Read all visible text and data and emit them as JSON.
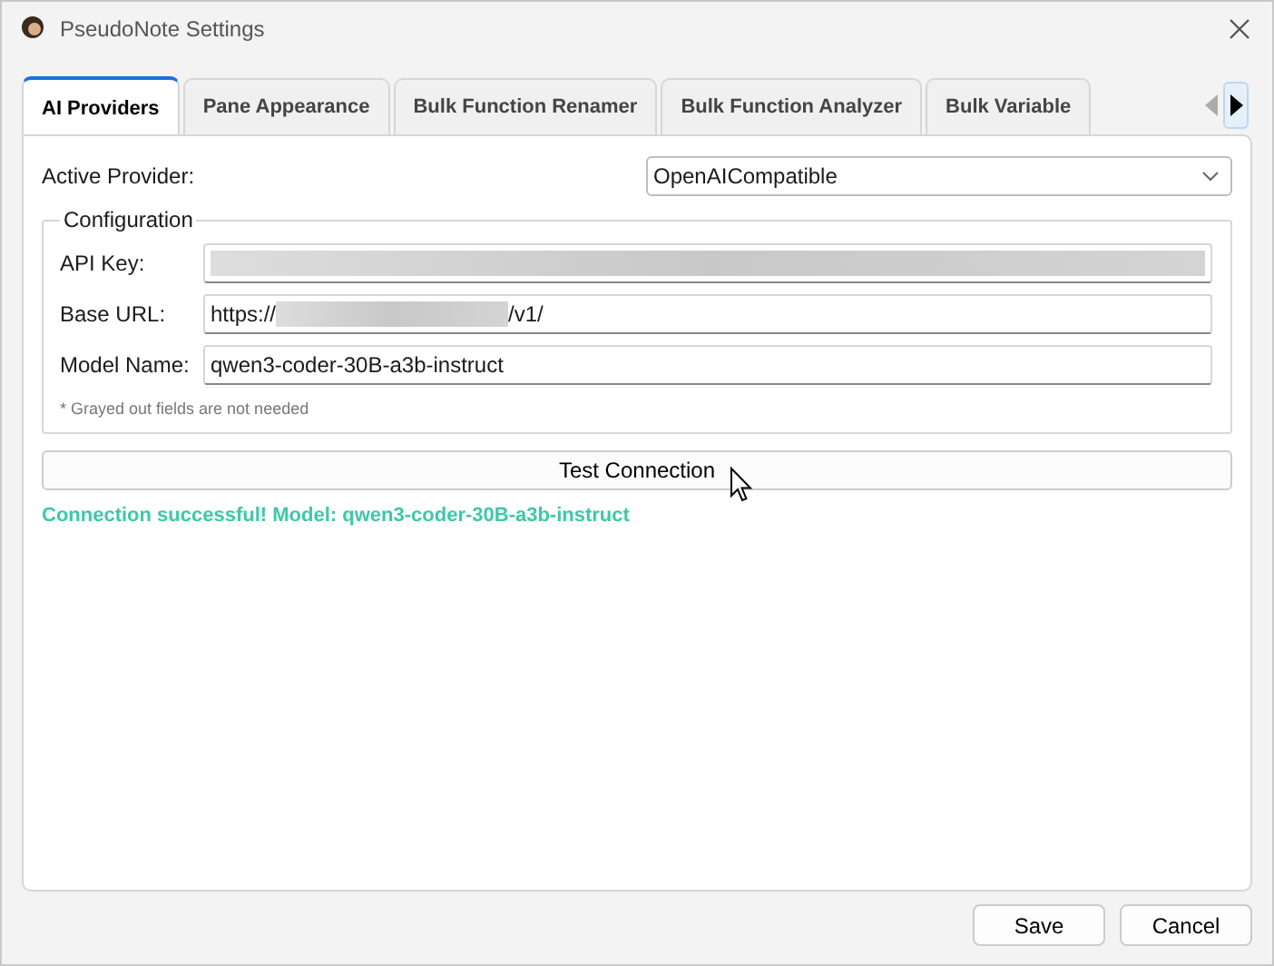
{
  "window": {
    "title": "PseudoNote Settings"
  },
  "tabs": [
    {
      "label": "AI Providers",
      "selected": true
    },
    {
      "label": "Pane Appearance",
      "selected": false
    },
    {
      "label": "Bulk Function Renamer",
      "selected": false
    },
    {
      "label": "Bulk Function Analyzer",
      "selected": false
    },
    {
      "label": "Bulk Variable",
      "selected": false
    }
  ],
  "active_provider": {
    "label": "Active Provider:",
    "value": "OpenAICompatible"
  },
  "configuration": {
    "title": "Configuration",
    "fields": [
      {
        "label": "API Key:",
        "kind": "redacted"
      },
      {
        "label": "Base URL:",
        "kind": "url",
        "prefix": "https://",
        "suffix": "/v1/"
      },
      {
        "label": "Model Name:",
        "kind": "text",
        "value": "qwen3-coder-30B-a3b-instruct"
      }
    ],
    "note": "* Grayed out fields are not needed"
  },
  "test_button": "Test Connection",
  "status": "Connection successful! Model: qwen3-coder-30B-a3b-instruct",
  "buttons": [
    "Save",
    "Cancel"
  ]
}
